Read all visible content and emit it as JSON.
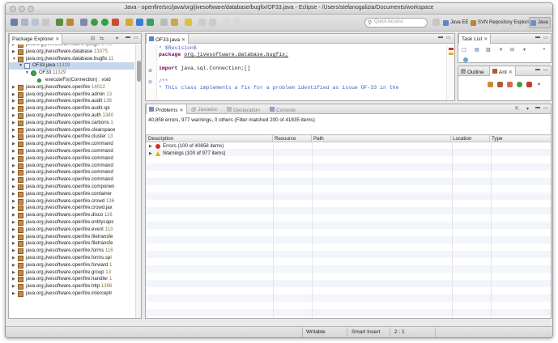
{
  "window": {
    "title": "Java - openfire/src/java/org/jivesoftware/database/bugfix/OF33.java - Eclipse - /Users/stefanogalizia/Documents/workspace"
  },
  "toolbar": {
    "quick_access_placeholder": "Quick Access"
  },
  "perspectives": [
    {
      "label": "Java EE",
      "icon": "java-ee-perspective-icon"
    },
    {
      "label": "SVN Repository Exploring",
      "icon": "svn-perspective-icon"
    },
    {
      "label": "Java",
      "icon": "java-perspective-icon"
    }
  ],
  "package_explorer": {
    "tab_label": "Package Explorer",
    "items": [
      {
        "label": "java.org.jivesoftware.admin.plugin",
        "num": "5793",
        "depth": 0,
        "expanded": false,
        "selected": false,
        "icon": "package-folder-icon"
      },
      {
        "label": "java.org.jivesoftware.database",
        "num": "13375",
        "depth": 0,
        "expanded": false,
        "selected": false,
        "icon": "package-folder-icon"
      },
      {
        "label": "java.org.jivesoftware.database.bugfix",
        "num": "11",
        "depth": 0,
        "expanded": true,
        "selected": false,
        "icon": "package-folder-icon"
      },
      {
        "label": "OF33.java",
        "num": "11329",
        "depth": 1,
        "expanded": true,
        "selected": true,
        "icon": "java-file-icon"
      },
      {
        "label": "OF33",
        "num": "11329",
        "depth": 2,
        "expanded": true,
        "selected": false,
        "icon": "class-icon"
      },
      {
        "label": "executeFix(Connection) : void",
        "num": "",
        "depth": 3,
        "expanded": null,
        "selected": false,
        "icon": "method-icon"
      },
      {
        "label": "java.org.jivesoftware.openfire",
        "num": "14012",
        "depth": 0,
        "expanded": false,
        "selected": false,
        "icon": "package-folder-icon"
      },
      {
        "label": "java.org.jivesoftware.openfire.admin",
        "num": "13",
        "depth": 0,
        "expanded": false,
        "selected": false,
        "icon": "package-folder-icon"
      },
      {
        "label": "java.org.jivesoftware.openfire.audit",
        "num": "136",
        "depth": 0,
        "expanded": false,
        "selected": false,
        "icon": "package-folder-icon"
      },
      {
        "label": "java.org.jivesoftware.openfire.audit.spi",
        "num": "",
        "depth": 0,
        "expanded": false,
        "selected": false,
        "icon": "package-folder-icon"
      },
      {
        "label": "java.org.jivesoftware.openfire.auth",
        "num": "1340",
        "depth": 0,
        "expanded": false,
        "selected": false,
        "icon": "package-folder-icon"
      },
      {
        "label": "java.org.jivesoftware.openfire.carbons",
        "num": "1",
        "depth": 0,
        "expanded": false,
        "selected": false,
        "icon": "package-folder-icon"
      },
      {
        "label": "java.org.jivesoftware.openfire.clearspace",
        "num": "",
        "depth": 0,
        "expanded": false,
        "selected": false,
        "icon": "package-folder-icon"
      },
      {
        "label": "java.org.jivesoftware.openfire.cluster",
        "num": "13",
        "depth": 0,
        "expanded": false,
        "selected": false,
        "icon": "package-folder-icon"
      },
      {
        "label": "java.org.jivesoftware.openfire.command",
        "num": "",
        "depth": 0,
        "expanded": false,
        "selected": false,
        "icon": "package-folder-icon"
      },
      {
        "label": "java.org.jivesoftware.openfire.command",
        "num": "",
        "depth": 0,
        "expanded": false,
        "selected": false,
        "icon": "package-folder-icon"
      },
      {
        "label": "java.org.jivesoftware.openfire.command",
        "num": "",
        "depth": 0,
        "expanded": false,
        "selected": false,
        "icon": "package-folder-icon"
      },
      {
        "label": "java.org.jivesoftware.openfire.command",
        "num": "",
        "depth": 0,
        "expanded": false,
        "selected": false,
        "icon": "package-folder-icon"
      },
      {
        "label": "java.org.jivesoftware.openfire.command",
        "num": "",
        "depth": 0,
        "expanded": false,
        "selected": false,
        "icon": "package-folder-icon"
      },
      {
        "label": "java.org.jivesoftware.openfire.command",
        "num": "",
        "depth": 0,
        "expanded": false,
        "selected": false,
        "icon": "package-folder-icon"
      },
      {
        "label": "java.org.jivesoftware.openfire.componen",
        "num": "",
        "depth": 0,
        "expanded": false,
        "selected": false,
        "icon": "package-folder-icon"
      },
      {
        "label": "java.org.jivesoftware.openfire.container",
        "num": "",
        "depth": 0,
        "expanded": false,
        "selected": false,
        "icon": "package-folder-icon"
      },
      {
        "label": "java.org.jivesoftware.openfire.crowd",
        "num": "136",
        "depth": 0,
        "expanded": false,
        "selected": false,
        "icon": "package-folder-icon"
      },
      {
        "label": "java.org.jivesoftware.openfire.crowd.jax",
        "num": "",
        "depth": 0,
        "expanded": false,
        "selected": false,
        "icon": "package-folder-icon"
      },
      {
        "label": "java.org.jivesoftware.openfire.disco",
        "num": "116",
        "depth": 0,
        "expanded": false,
        "selected": false,
        "icon": "package-folder-icon"
      },
      {
        "label": "java.org.jivesoftware.openfire.entitycaps",
        "num": "",
        "depth": 0,
        "expanded": false,
        "selected": false,
        "icon": "package-folder-icon"
      },
      {
        "label": "java.org.jivesoftware.openfire.event",
        "num": "113",
        "depth": 0,
        "expanded": false,
        "selected": false,
        "icon": "package-folder-icon"
      },
      {
        "label": "java.org.jivesoftware.openfire.filetransfe",
        "num": "",
        "depth": 0,
        "expanded": false,
        "selected": false,
        "icon": "package-folder-icon"
      },
      {
        "label": "java.org.jivesoftware.openfire.filetransfe",
        "num": "",
        "depth": 0,
        "expanded": false,
        "selected": false,
        "icon": "package-folder-icon"
      },
      {
        "label": "java.org.jivesoftware.openfire.forms",
        "num": "116",
        "depth": 0,
        "expanded": false,
        "selected": false,
        "icon": "package-folder-icon"
      },
      {
        "label": "java.org.jivesoftware.openfire.forms.spi",
        "num": "",
        "depth": 0,
        "expanded": false,
        "selected": false,
        "icon": "package-folder-icon"
      },
      {
        "label": "java.org.jivesoftware.openfire.forward",
        "num": "1",
        "depth": 0,
        "expanded": false,
        "selected": false,
        "icon": "package-folder-icon"
      },
      {
        "label": "java.org.jivesoftware.openfire.group",
        "num": "13",
        "depth": 0,
        "expanded": false,
        "selected": false,
        "icon": "package-folder-icon"
      },
      {
        "label": "java.org.jivesoftware.openfire.handler",
        "num": "1",
        "depth": 0,
        "expanded": false,
        "selected": false,
        "icon": "package-folder-icon"
      },
      {
        "label": "java.org.jivesoftware.openfire.http",
        "num": "1396",
        "depth": 0,
        "expanded": false,
        "selected": false,
        "icon": "package-folder-icon"
      },
      {
        "label": "java.org.jivesoftware.openfire.interceptr",
        "num": "",
        "depth": 0,
        "expanded": false,
        "selected": false,
        "icon": "package-folder-icon"
      }
    ]
  },
  "editor": {
    "tab_label": "OF33.java",
    "lines": [
      {
        "parts": [
          {
            "t": " * $Revision$",
            "c": "cm"
          }
        ]
      },
      {
        "parts": [
          {
            "t": "package ",
            "c": "kw"
          },
          {
            "t": "org.jivesoftware.database.bugfix;",
            "c": ""
          }
        ]
      },
      {
        "parts": [
          {
            "t": "",
            "c": ""
          }
        ]
      },
      {
        "parts": [
          {
            "t": "import ",
            "c": "kw"
          },
          {
            "t": "java.sql.Connection;[]",
            "c": ""
          }
        ]
      },
      {
        "parts": [
          {
            "t": "",
            "c": ""
          }
        ]
      },
      {
        "parts": [
          {
            "t": "/**",
            "c": "cm"
          }
        ]
      },
      {
        "parts": [
          {
            "t": " * This class implements a fix for a problem identified as issue OF-33 in the",
            "c": "cm"
          }
        ]
      }
    ]
  },
  "task_list": {
    "tab_label": "Task List"
  },
  "outline": {
    "tab_label": "Outline",
    "ant_tab_label": "Ant"
  },
  "problems": {
    "tabs": [
      "Problems",
      "Javadoc",
      "Declaration",
      "Console"
    ],
    "summary": "40,858 errors, 977 warnings, 0 others (Filter matched 200 of 41835 items)",
    "columns": [
      "Description",
      "Resource",
      "Path",
      "Location",
      "Type"
    ],
    "rows": [
      {
        "label": "Errors (100 of 40858 items)",
        "icon": "error-icon"
      },
      {
        "label": "Warnings (100 of 977 items)",
        "icon": "warning-icon"
      }
    ]
  },
  "statusbar": {
    "writable": "Writable",
    "insert_mode": "Smart Insert",
    "position": "2 : 1"
  },
  "colors": {
    "selection": "#c5d6ee",
    "error": "#d9302a",
    "warning": "#e8b100"
  }
}
